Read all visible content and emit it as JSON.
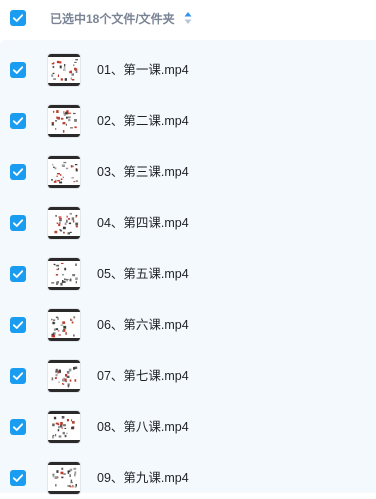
{
  "header": {
    "select_all_checked": true,
    "selection_label": "已选中18个文件/文件夹",
    "sort_icon": "sort-toggle-icon"
  },
  "colors": {
    "checkbox": "#1a9cf0",
    "list_background": "#f4f9fd",
    "header_text": "#7b8494",
    "file_text": "#1f2329"
  },
  "files": [
    {
      "name": "01、第一课.mp4",
      "checked": true,
      "thumbnail": "video-thumbnail"
    },
    {
      "name": "02、第二课.mp4",
      "checked": true,
      "thumbnail": "video-thumbnail"
    },
    {
      "name": "03、第三课.mp4",
      "checked": true,
      "thumbnail": "video-thumbnail"
    },
    {
      "name": "04、第四课.mp4",
      "checked": true,
      "thumbnail": "video-thumbnail"
    },
    {
      "name": "05、第五课.mp4",
      "checked": true,
      "thumbnail": "video-thumbnail"
    },
    {
      "name": "06、第六课.mp4",
      "checked": true,
      "thumbnail": "video-thumbnail"
    },
    {
      "name": "07、第七课.mp4",
      "checked": true,
      "thumbnail": "video-thumbnail"
    },
    {
      "name": "08、第八课.mp4",
      "checked": true,
      "thumbnail": "video-thumbnail"
    },
    {
      "name": "09、第九课.mp4",
      "checked": true,
      "thumbnail": "video-thumbnail"
    }
  ]
}
